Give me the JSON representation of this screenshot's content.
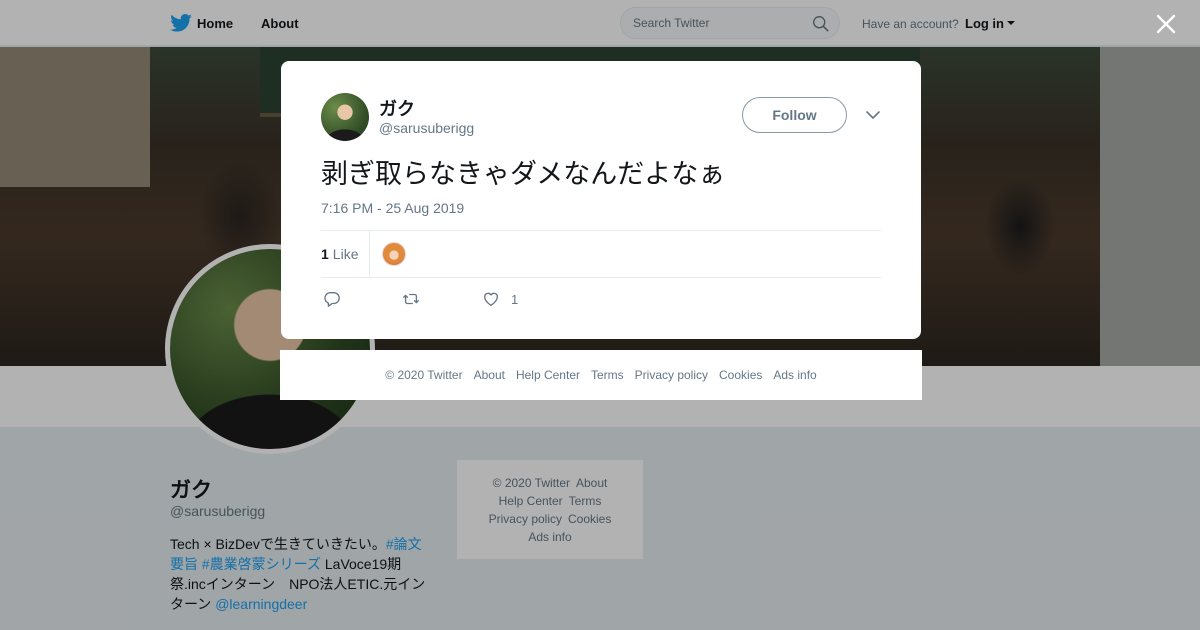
{
  "nav": {
    "home_label": "Home",
    "about_label": "About",
    "search_placeholder": "Search Twitter",
    "have_account": "Have an account?",
    "login_label": "Log in"
  },
  "profile": {
    "name": "ガク",
    "handle": "@sarusuberigg",
    "bio_text": "Tech × BizDevで生きていきたい。",
    "bio_tag1": "#論文要旨",
    "bio_tag2": "#農業啓蒙シリーズ",
    "bio_text2": " LaVoce19期祭.incインターン　NPO法人ETIC.元インターン ",
    "bio_mention": "@learningdeer"
  },
  "side_footer": {
    "copyright": "© 2020 Twitter",
    "about": "About",
    "help": "Help Center",
    "terms": "Terms",
    "privacy": "Privacy policy",
    "cookies": "Cookies",
    "ads": "Ads info"
  },
  "tweet": {
    "name": "ガク",
    "handle": "@sarusuberigg",
    "follow_label": "Follow",
    "text": "剥ぎ取らなきゃダメなんだよなぁ",
    "timestamp": "7:16 PM - 25 Aug 2019",
    "likes_count": "1",
    "likes_label": "Like",
    "like_action_count": "1"
  },
  "modal_footer": {
    "copyright": "© 2020 Twitter",
    "about": "About",
    "help": "Help Center",
    "terms": "Terms",
    "privacy": "Privacy policy",
    "cookies": "Cookies",
    "ads": "Ads info"
  },
  "colors": {
    "accent": "#1da1f2",
    "muted": "#657786",
    "text": "#14171a"
  }
}
